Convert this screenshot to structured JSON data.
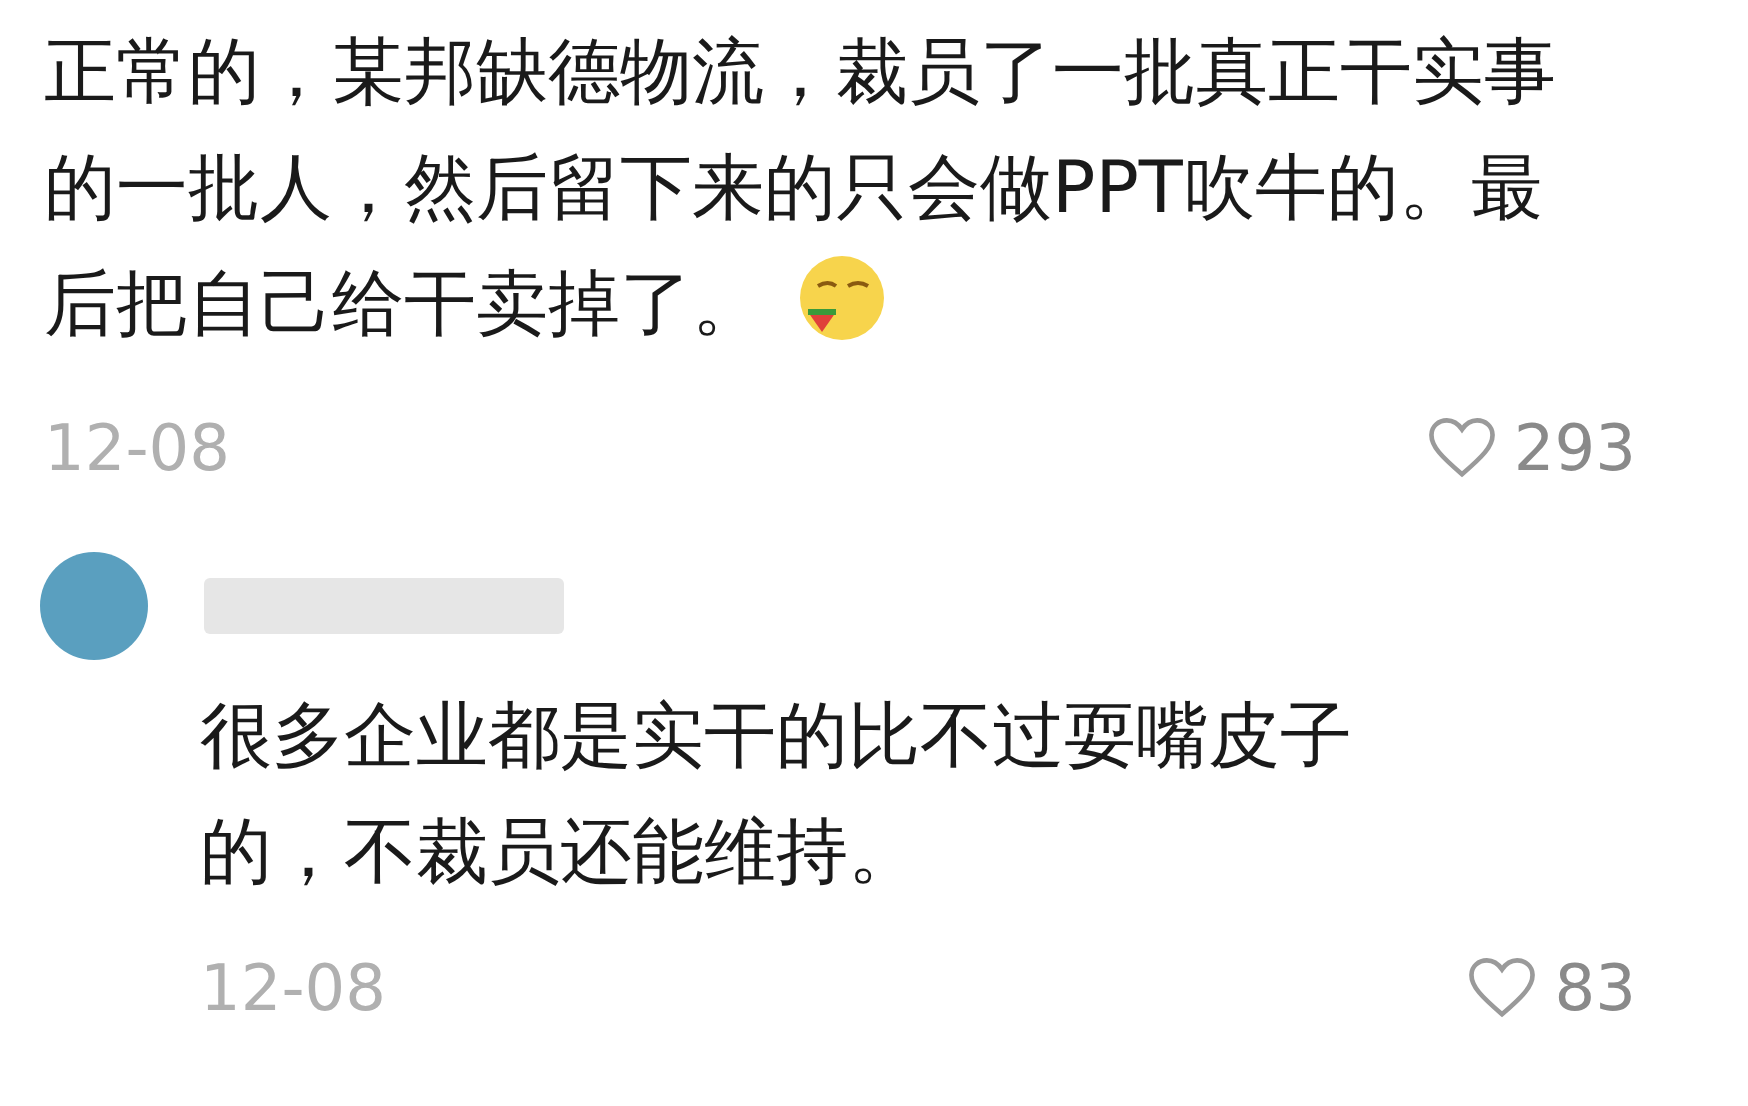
{
  "comment": {
    "text": "正常的，某邦缺德物流，裁员了一批真正干实事的一批人，然后留下来的只会做PPT吹牛的。最后把自己给干卖掉了。",
    "date": "12-08",
    "likes": "293"
  },
  "reply": {
    "text": "很多企业都是实干的比不过耍嘴皮子的，不裁员还能维持。",
    "date": "12-08",
    "likes": "83"
  }
}
